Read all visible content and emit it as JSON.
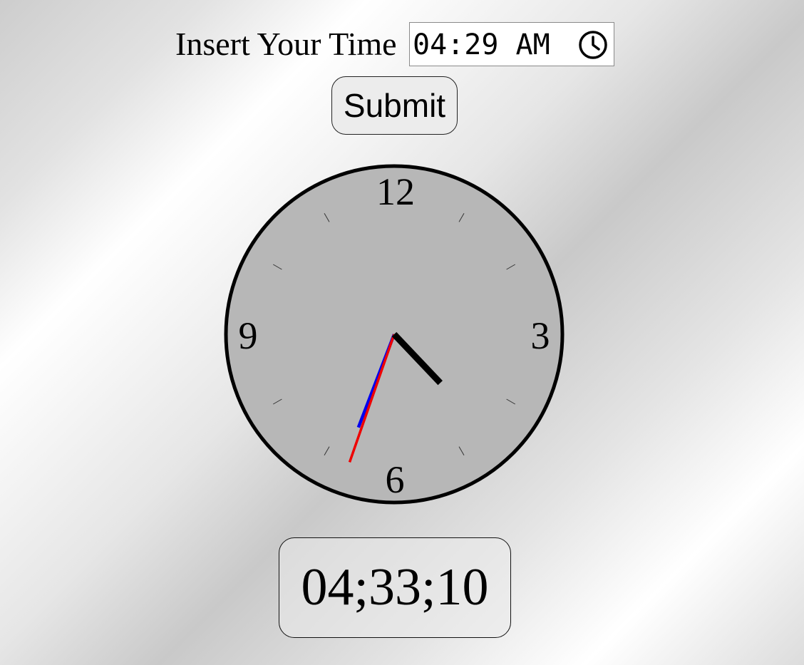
{
  "form": {
    "label": "Insert Your Time",
    "time_value": "04:29 AM",
    "time_icon": "clock-icon",
    "submit_label": "Submit"
  },
  "clock": {
    "numerals": {
      "twelve": "12",
      "three": "3",
      "six": "6",
      "nine": "9"
    },
    "hands": {
      "hour": {
        "value": 4.55,
        "unit": "hours",
        "color": "#000000"
      },
      "minute": {
        "value": 33.2,
        "unit": "minutes",
        "color": "#ee0000"
      },
      "second": {
        "value": 33.5,
        "unit": "seconds",
        "color": "#0000ee"
      }
    },
    "face_color": "#b7b7b7",
    "rim_color": "#000000"
  },
  "digital": {
    "time": "04;33;10"
  }
}
